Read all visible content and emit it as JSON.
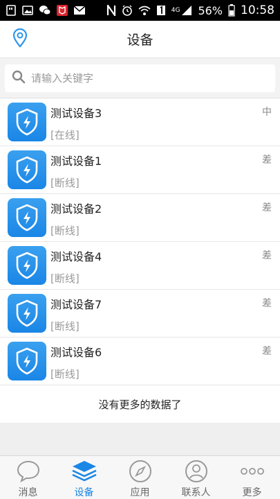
{
  "status_bar": {
    "network": "4G",
    "battery": "56%",
    "time": "10:58"
  },
  "header": {
    "title": "设备"
  },
  "search": {
    "placeholder": "请输入关键字"
  },
  "devices": [
    {
      "name": "测试设备3",
      "status": "[在线]",
      "signal": "中"
    },
    {
      "name": "测试设备1",
      "status": "[断线]",
      "signal": "差"
    },
    {
      "name": "测试设备2",
      "status": "[断线]",
      "signal": "差"
    },
    {
      "name": "测试设备4",
      "status": "[断线]",
      "signal": "差"
    },
    {
      "name": "测试设备7",
      "status": "[断线]",
      "signal": "差"
    },
    {
      "name": "测试设备6",
      "status": "[断线]",
      "signal": "差"
    }
  ],
  "list_footer": "没有更多的数据了",
  "tabs": [
    {
      "label": "消息",
      "icon": "chat-bubble-icon"
    },
    {
      "label": "设备",
      "icon": "layers-icon",
      "active": true
    },
    {
      "label": "应用",
      "icon": "compass-icon"
    },
    {
      "label": "联系人",
      "icon": "person-icon"
    },
    {
      "label": "更多",
      "icon": "more-dots-icon"
    }
  ],
  "colors": {
    "accent": "#1a86e6",
    "icon_bg": "#2b95ec"
  }
}
